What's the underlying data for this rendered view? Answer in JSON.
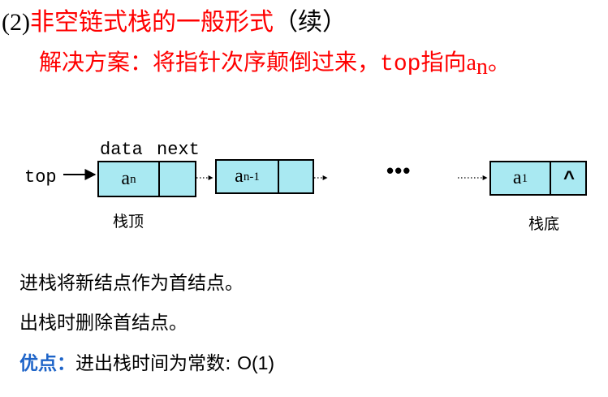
{
  "heading": {
    "number": "(2)",
    "title": "非空链式栈的一般形式",
    "suffix": "（续）"
  },
  "solution": {
    "prefix": "解决方案：将指针次序颠倒过来，",
    "top_word": "top",
    "middle": "指向",
    "a": "a",
    "a_sub": "n",
    "end": "。"
  },
  "diagram": {
    "field_data_label": "data",
    "field_next_label": "next",
    "top_label": "top",
    "nodes": [
      {
        "value": "a",
        "sub": "n"
      },
      {
        "value": "a",
        "sub": "n-1"
      },
      {
        "value": "a",
        "sub": "1",
        "next_value": "^"
      }
    ],
    "ellipsis": "•••",
    "caption_top": "栈顶",
    "caption_bottom": "栈底"
  },
  "body": {
    "push_text": "进栈将新结点作为首结点。",
    "pop_text": "出栈时删除首结点。",
    "advantage_label": "优点：",
    "advantage_text": "进出栈时间为常数: ",
    "complexity": "O(1)"
  },
  "colors": {
    "heading_red": "#ff0000",
    "node_fill": "#a9e9f2",
    "advantage_blue": "#1e64c8"
  }
}
